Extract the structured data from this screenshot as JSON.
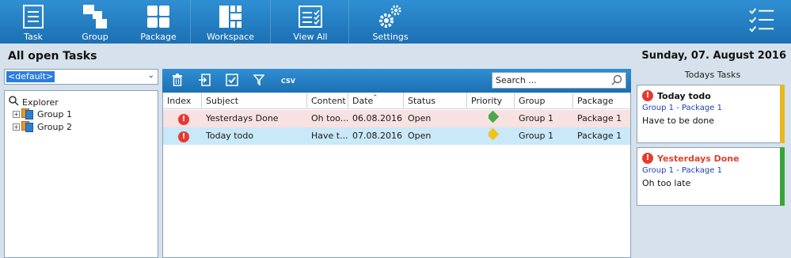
{
  "ribbon": {
    "buttons": [
      {
        "label": "Task",
        "icon": "task-icon"
      },
      {
        "label": "Group",
        "icon": "group-icon"
      },
      {
        "label": "Package",
        "icon": "package-icon"
      },
      {
        "label": "Workspace",
        "icon": "workspace-icon"
      },
      {
        "label": "View All",
        "icon": "view-all-icon"
      },
      {
        "label": "Settings",
        "icon": "settings-icon"
      }
    ],
    "menu_icon": "checklist-menu-icon"
  },
  "page": {
    "title": "All open Tasks",
    "date": "Sunday, 07. August 2016"
  },
  "filter": {
    "selected": "<default>"
  },
  "explorer": {
    "root": "Explorer",
    "groups": [
      "Group 1",
      "Group 2"
    ]
  },
  "toolbar": {
    "icons": [
      "trash-icon",
      "import-icon",
      "check-icon",
      "filter-icon",
      "csv-export-icon"
    ],
    "csv_label": "CSV",
    "search_placeholder": "Search ..."
  },
  "grid": {
    "columns": [
      "Index",
      "Subject",
      "Content",
      "Date",
      "Status",
      "Priority",
      "Group",
      "Package"
    ],
    "rows": [
      {
        "subject": "Yesterdays Done",
        "content": "Oh too...",
        "date": "06.08.2016",
        "status": "Open",
        "priority": "low",
        "group": "Group 1",
        "package": "Package 1",
        "color": "#f7e1e1"
      },
      {
        "subject": "Today todo",
        "content": "Have t...",
        "date": "07.08.2016",
        "status": "Open",
        "priority": "medium",
        "group": "Group 1",
        "package": "Package 1",
        "color": "#c9e8f8"
      }
    ]
  },
  "today": {
    "title": "Todays Tasks",
    "cards": [
      {
        "title": "Today todo",
        "sub": "Group 1 - Package 1",
        "body": "Have to be done",
        "title_color": "#111111",
        "bar_color": "#e8b820"
      },
      {
        "title": "Yesterdays Done",
        "sub": "Group 1 - Package 1",
        "body": "Oh too late",
        "title_color": "#e0402e",
        "bar_color": "#3aa33a"
      }
    ]
  },
  "colors": {
    "accent": "#1f78bf",
    "warning": "#e53a32",
    "priority_low": "#4aa84a",
    "priority_medium": "#f2c21b"
  }
}
